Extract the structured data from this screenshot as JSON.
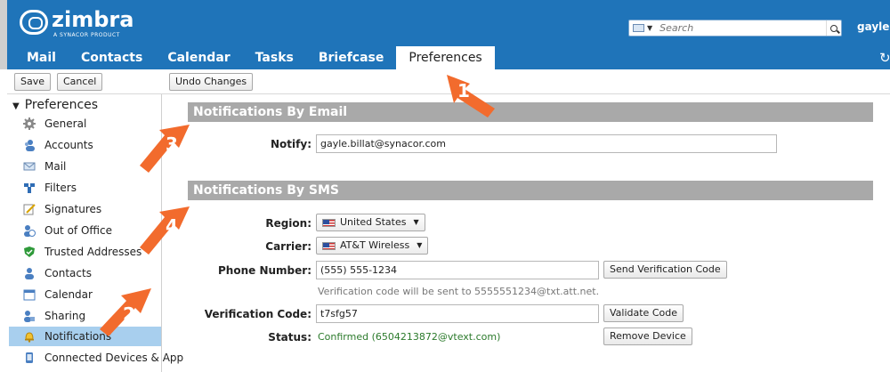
{
  "app": {
    "logo_word": "zimbra",
    "logo_sub": "A SYNACOR PRODUCT",
    "search_placeholder": "Search",
    "user_menu": "gayle ▾"
  },
  "tabs": [
    {
      "label": "Mail",
      "active": false
    },
    {
      "label": "Contacts",
      "active": false
    },
    {
      "label": "Calendar",
      "active": false
    },
    {
      "label": "Tasks",
      "active": false
    },
    {
      "label": "Briefcase",
      "active": false
    },
    {
      "label": "Preferences",
      "active": true
    }
  ],
  "toolbar": {
    "save_label": "Save",
    "cancel_label": "Cancel",
    "undo_label": "Undo Changes"
  },
  "sidebar": {
    "heading": "Preferences",
    "items": [
      {
        "label": "General",
        "icon": "gear-icon",
        "selected": false
      },
      {
        "label": "Accounts",
        "icon": "accounts-icon",
        "selected": false
      },
      {
        "label": "Mail",
        "icon": "envelope-icon",
        "selected": false
      },
      {
        "label": "Filters",
        "icon": "filter-icon",
        "selected": false
      },
      {
        "label": "Signatures",
        "icon": "signature-icon",
        "selected": false
      },
      {
        "label": "Out of Office",
        "icon": "out-of-office-icon",
        "selected": false
      },
      {
        "label": "Trusted Addresses",
        "icon": "shield-icon",
        "selected": false
      },
      {
        "label": "Contacts",
        "icon": "contact-icon",
        "selected": false
      },
      {
        "label": "Calendar",
        "icon": "calendar-icon",
        "selected": false
      },
      {
        "label": "Sharing",
        "icon": "sharing-icon",
        "selected": false
      },
      {
        "label": "Notifications",
        "icon": "bell-icon",
        "selected": true
      },
      {
        "label": "Connected Devices & App",
        "icon": "device-icon",
        "selected": false
      }
    ]
  },
  "email_section": {
    "title": "Notifications By Email",
    "notify_label": "Notify:",
    "notify_value": "gayle.billat@synacor.com"
  },
  "sms_section": {
    "title": "Notifications By SMS",
    "region_label": "Region:",
    "region_value": "United States",
    "carrier_label": "Carrier:",
    "carrier_value": "AT&T Wireless",
    "phone_label": "Phone Number:",
    "phone_value": "(555) 555-1234",
    "send_code_label": "Send Verification Code",
    "hint": "Verification code will be sent to 5555551234@txt.att.net.",
    "code_label": "Verification Code:",
    "code_value": "t7sfg57",
    "validate_label": "Validate Code",
    "status_label": "Status:",
    "status_value": "Confirmed (6504213872@vtext.com)",
    "remove_label": "Remove Device"
  },
  "callouts": [
    "1",
    "2",
    "3",
    "4"
  ],
  "colors": {
    "header_blue": "#1f74b9",
    "section_gray": "#a9a9a9",
    "selected_item": "#a8cfee",
    "callout_orange": "#f26b2d",
    "status_green": "#2b7a2b"
  }
}
